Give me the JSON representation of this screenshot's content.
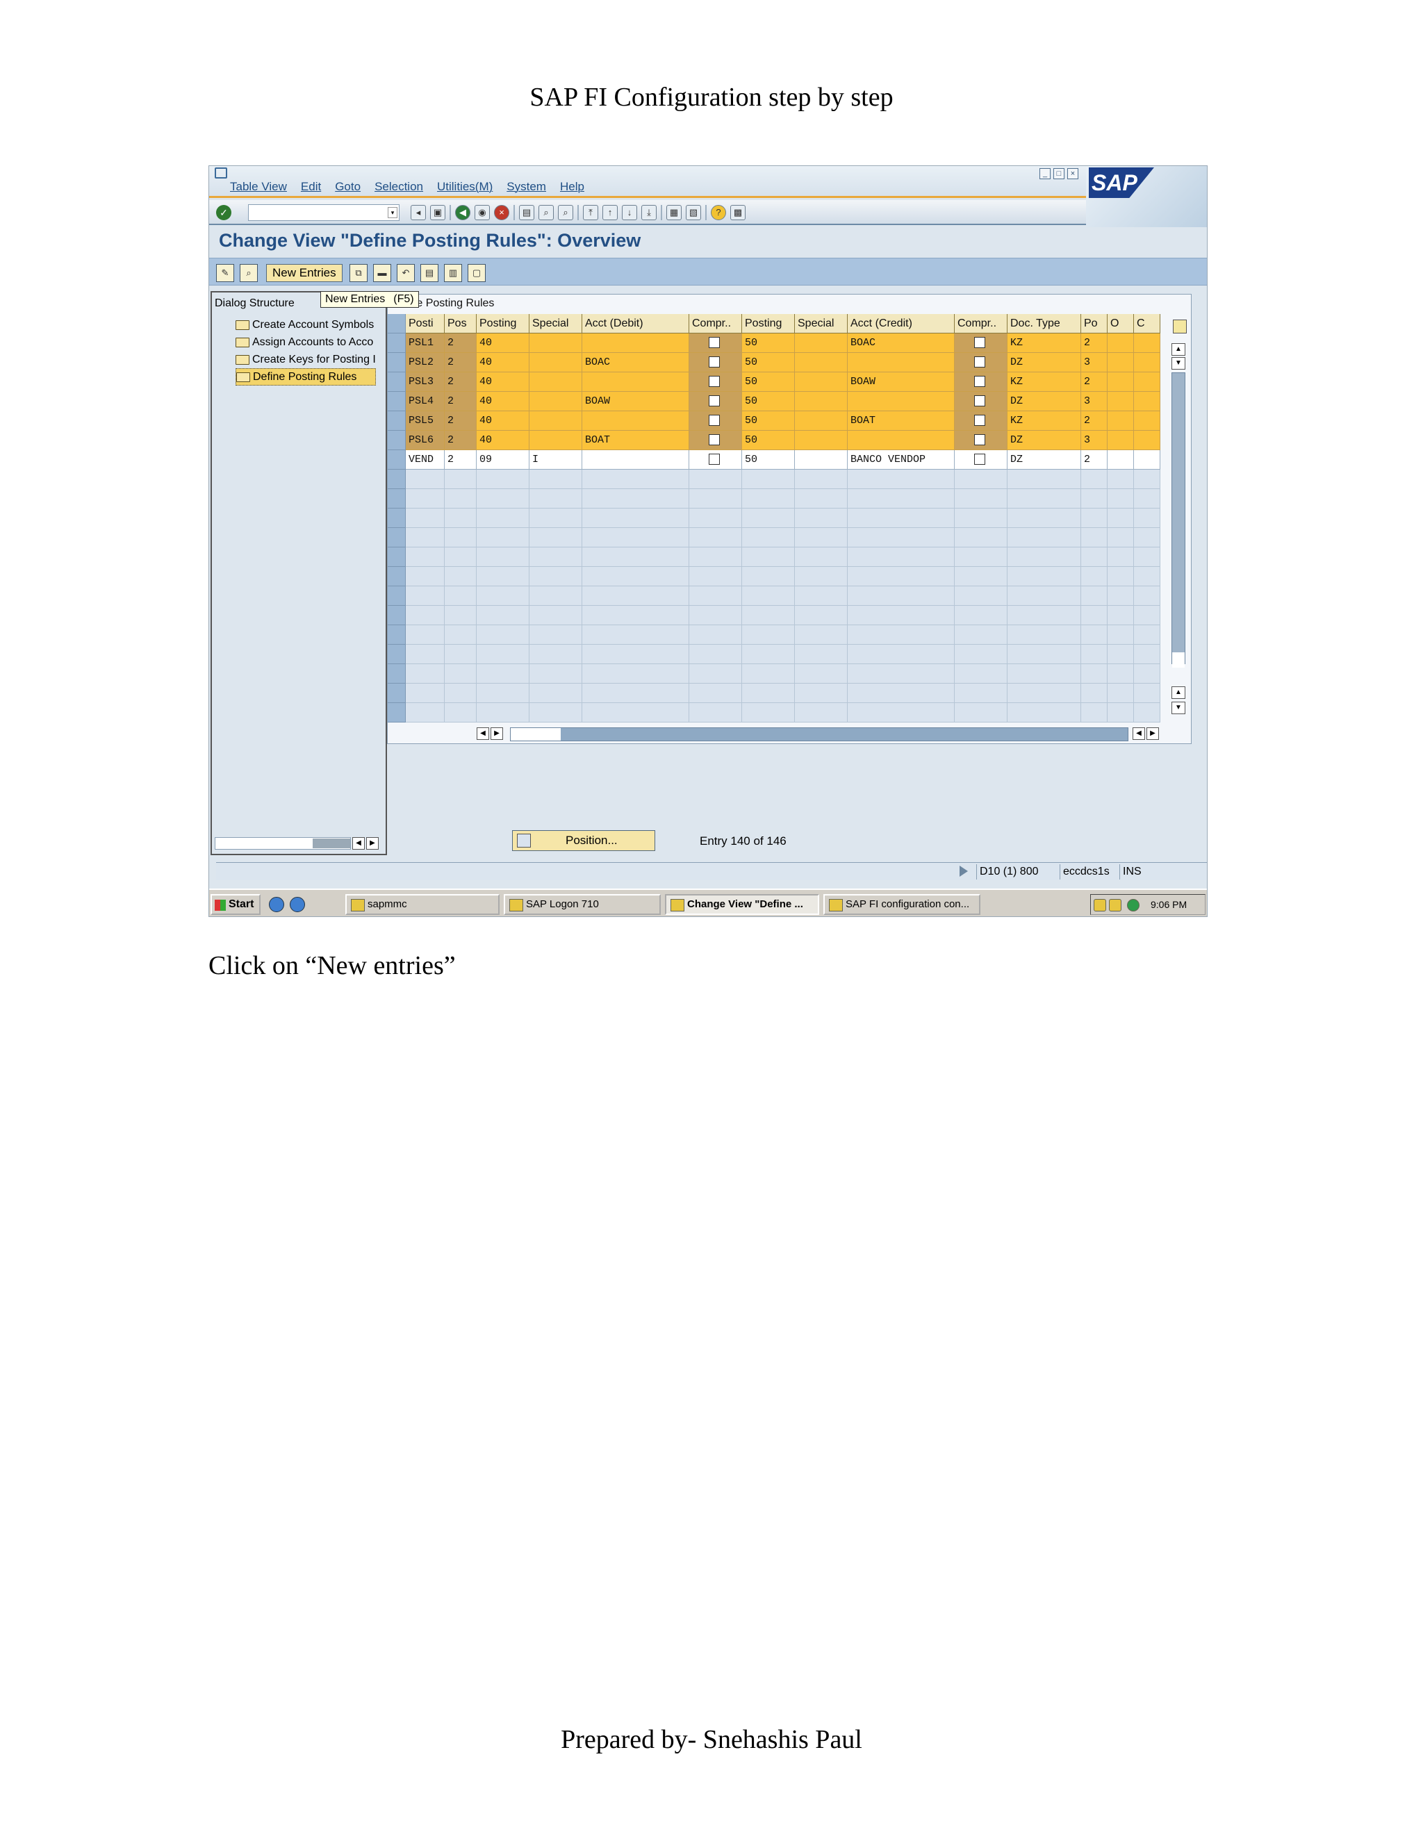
{
  "document": {
    "header": "SAP FI Configuration step by step",
    "instruction": "Click on “New entries”",
    "footer": "Prepared by- Snehashis Paul"
  },
  "sap": {
    "menu": [
      "Table View",
      "Edit",
      "Goto",
      "Selection",
      "Utilities(M)",
      "System",
      "Help"
    ],
    "logo": "SAP",
    "title": "Change View \"Define Posting Rules\": Overview",
    "new_entries_label": "New Entries",
    "tooltip": {
      "text": "New Entries",
      "key": "(F5)"
    },
    "dialog_structure": {
      "title": "Dialog Structure",
      "items": [
        "Create Account Symbols",
        "Assign Accounts to Acco",
        "Create Keys for Posting I",
        "Define Posting Rules"
      ],
      "selected_index": 3
    },
    "table": {
      "title": "Define Posting Rules",
      "columns": [
        "Posti",
        "Pos",
        "Posting",
        "Special",
        "Acct (Debit)",
        "Compr..",
        "Posting",
        "Special",
        "Acct (Credit)",
        "Compr..",
        "Doc. Type",
        "Po",
        "O",
        "C"
      ],
      "rows": [
        [
          "PSL1",
          "2",
          "40",
          "",
          "",
          "",
          "50",
          "",
          "BOAC",
          "",
          "KZ",
          "2",
          "",
          ""
        ],
        [
          "PSL2",
          "2",
          "40",
          "",
          "BOAC",
          "",
          "50",
          "",
          "",
          "",
          "DZ",
          "3",
          "",
          ""
        ],
        [
          "PSL3",
          "2",
          "40",
          "",
          "",
          "",
          "50",
          "",
          "BOAW",
          "",
          "KZ",
          "2",
          "",
          ""
        ],
        [
          "PSL4",
          "2",
          "40",
          "",
          "BOAW",
          "",
          "50",
          "",
          "",
          "",
          "DZ",
          "3",
          "",
          ""
        ],
        [
          "PSL5",
          "2",
          "40",
          "",
          "",
          "",
          "50",
          "",
          "BOAT",
          "",
          "KZ",
          "2",
          "",
          ""
        ],
        [
          "PSL6",
          "2",
          "40",
          "",
          "BOAT",
          "",
          "50",
          "",
          "",
          "",
          "DZ",
          "3",
          "",
          ""
        ],
        [
          "VEND",
          "2",
          "09",
          "I",
          "",
          "",
          "50",
          "",
          "BANCO VENDOP",
          "",
          "DZ",
          "2",
          "",
          ""
        ]
      ],
      "highlighted_rows": 6,
      "empty_rows": 13
    },
    "position_button": "Position...",
    "entry_info": "Entry 140 of 146",
    "status": {
      "system": "D10 (1) 800",
      "server": "eccdcs1s",
      "mode": "INS"
    },
    "taskbar": {
      "start": "Start",
      "tasks": [
        "sapmmc",
        "SAP Logon 710",
        "Change View \"Define ...",
        "SAP FI configuration con..."
      ],
      "active_task_index": 2,
      "clock": "9:06 PM"
    },
    "colors": {
      "accent": "#234f84",
      "row_highlight": "#fbc23a",
      "app_toolbar": "#a9c3df"
    }
  }
}
